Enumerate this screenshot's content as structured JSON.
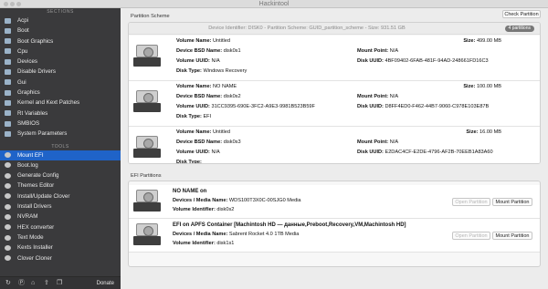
{
  "window": {
    "title": "Hackintool"
  },
  "sidebar": {
    "sections_header": "SECTIONS",
    "tools_header": "TOOLS",
    "sections": [
      {
        "label": "Acpi",
        "icon": "folder-icon"
      },
      {
        "label": "Boot",
        "icon": "folder-icon"
      },
      {
        "label": "Boot Graphics",
        "icon": "folder-icon"
      },
      {
        "label": "Cpu",
        "icon": "folder-icon"
      },
      {
        "label": "Devices",
        "icon": "folder-icon"
      },
      {
        "label": "Disable Drivers",
        "icon": "folder-icon"
      },
      {
        "label": "Gui",
        "icon": "folder-icon"
      },
      {
        "label": "Graphics",
        "icon": "folder-icon"
      },
      {
        "label": "Kernel and Kext Patches",
        "icon": "folder-icon"
      },
      {
        "label": "Rt Variables",
        "icon": "folder-icon"
      },
      {
        "label": "SMBIOS",
        "icon": "folder-icon"
      },
      {
        "label": "System Parameters",
        "icon": "folder-icon"
      }
    ],
    "tools": [
      {
        "label": "Mount EFI",
        "icon": "drive-icon",
        "selected": true
      },
      {
        "label": "Boot.log",
        "icon": "document-icon"
      },
      {
        "label": "Generate Config",
        "icon": "gear-icon"
      },
      {
        "label": "Themes Editor",
        "icon": "paintbrush-icon"
      },
      {
        "label": "Install/Update Clover",
        "icon": "clover-icon"
      },
      {
        "label": "Install Drivers",
        "icon": "download-icon"
      },
      {
        "label": "NVRAM",
        "icon": "chip-icon"
      },
      {
        "label": "HEX converter",
        "icon": "hex-icon"
      },
      {
        "label": "Text Mode",
        "icon": "text-icon"
      },
      {
        "label": "Kexts Installer",
        "icon": "kext-icon"
      },
      {
        "label": "Clover Cloner",
        "icon": "clone-icon"
      }
    ],
    "bottom_bar": {
      "icons": [
        "refresh-icon",
        "paypal-icon",
        "home-icon",
        "share-icon",
        "pp-icon"
      ],
      "donate_label": "Donate"
    }
  },
  "partition_scheme": {
    "group_label": "Partition Scheme",
    "check_button": "Check Partition",
    "header": "Device Identifier: DISK0 - Partition Scheme: GUID_partition_scheme - Size: 931.51 GB",
    "badge": "4 partitions",
    "labels": {
      "volume_name": "Volume Name:",
      "device_bsd": "Device BSD Name:",
      "volume_uuid": "Volume UUID:",
      "disk_type": "Disk Type:",
      "size": "Size:",
      "mount_point": "Mount Point:",
      "disk_uuid": "Disk UUID:"
    },
    "partitions": [
      {
        "volume_name": "Untitled",
        "device_bsd": "disk0s1",
        "volume_uuid": "N/A",
        "disk_type": "Windows Recovery",
        "size": "499.00 MB",
        "mount_point": "N/A",
        "disk_uuid": "4BF09402-6FAB-481F-94AD-248661FD16C3"
      },
      {
        "volume_name": "NO NAME",
        "device_bsd": "disk0s2",
        "volume_uuid": "31CC9395-690E-3FC2-A9E3-9981B523B59F",
        "disk_type": "EFI",
        "size": "100.00 MB",
        "mount_point": "N/A",
        "disk_uuid": "D8FF4ED0-F462-44B7-9060-C978E103E87B"
      },
      {
        "volume_name": "Untitled",
        "device_bsd": "disk0s3",
        "volume_uuid": "N/A",
        "disk_type": "",
        "size": "16.00 MB",
        "mount_point": "N/A",
        "disk_uuid": "E2DAC4CF-E2DE-4796-AF2B-70EEB1A83A60"
      }
    ]
  },
  "efi_partitions": {
    "group_label": "EFI Partitions",
    "labels": {
      "devices_media": "Devices / Media Name:",
      "volume_identifier": "Volume Identifier:"
    },
    "open_button": "Open Partition",
    "mount_button": "Mount Partition",
    "items": [
      {
        "title": "NO NAME on",
        "devices_media": "WDS100T3X0C-00SJG0 Media",
        "volume_identifier": "disk0s2"
      },
      {
        "title": "EFI on APFS Container [Machintosh HD — данные,Preboot,Recovery,VM,Machintosh HD]",
        "devices_media": "Sabrent Rocket 4.0 1TB Media",
        "volume_identifier": "disk1s1"
      }
    ]
  }
}
